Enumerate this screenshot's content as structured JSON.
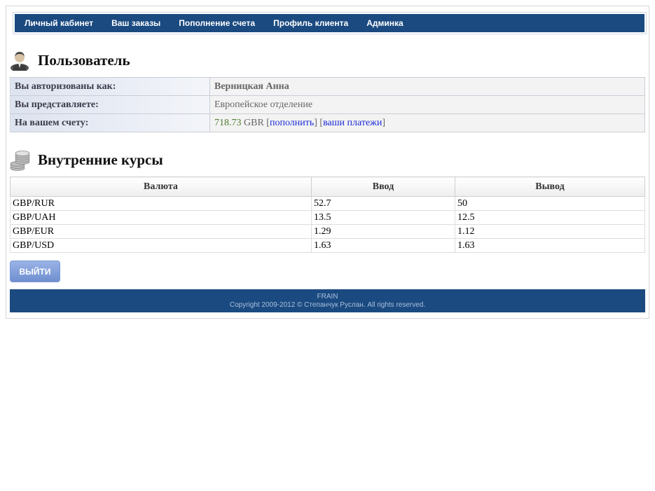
{
  "nav": {
    "items": [
      {
        "label": "Личный кабинет"
      },
      {
        "label": "Ваш заказы"
      },
      {
        "label": "Пополнение счета"
      },
      {
        "label": "Профиль клиента"
      },
      {
        "label": "Админка"
      }
    ]
  },
  "user_section": {
    "title": "Пользователь",
    "icon": "user-icon",
    "rows": [
      {
        "label": "Вы авторизованы как:",
        "value": "Верницкая Анна"
      },
      {
        "label": "Вы представляете:",
        "value": "Европейское отделение"
      },
      {
        "label": "На вашем счету:",
        "amount": "718.73",
        "currency": "GBR",
        "topup_link": "пополнить",
        "payments_link": "ваши платежи"
      }
    ]
  },
  "rates_section": {
    "title": "Внутренние курсы",
    "icon": "coins-icon",
    "headers": [
      "Валюта",
      "Ввод",
      "Вывод"
    ],
    "rows": [
      [
        "GBP/RUR",
        "52.7",
        "50"
      ],
      [
        "GBP/UAH",
        "13.5",
        "12.5"
      ],
      [
        "GBP/EUR",
        "1.29",
        "1.12"
      ],
      [
        "GBP/USD",
        "1.63",
        "1.63"
      ]
    ]
  },
  "logout_button": "ВЫЙТИ",
  "footer": {
    "line1": "FRAIN",
    "line2": "Copyright 2009-2012 © Степанчук Руслан. All rights reserved."
  },
  "colors": {
    "nav_bg": "#1a4a80",
    "button_bg": "#7f9bd8",
    "amount_color": "#4e7d2c",
    "link_color": "#1a2ad6"
  }
}
